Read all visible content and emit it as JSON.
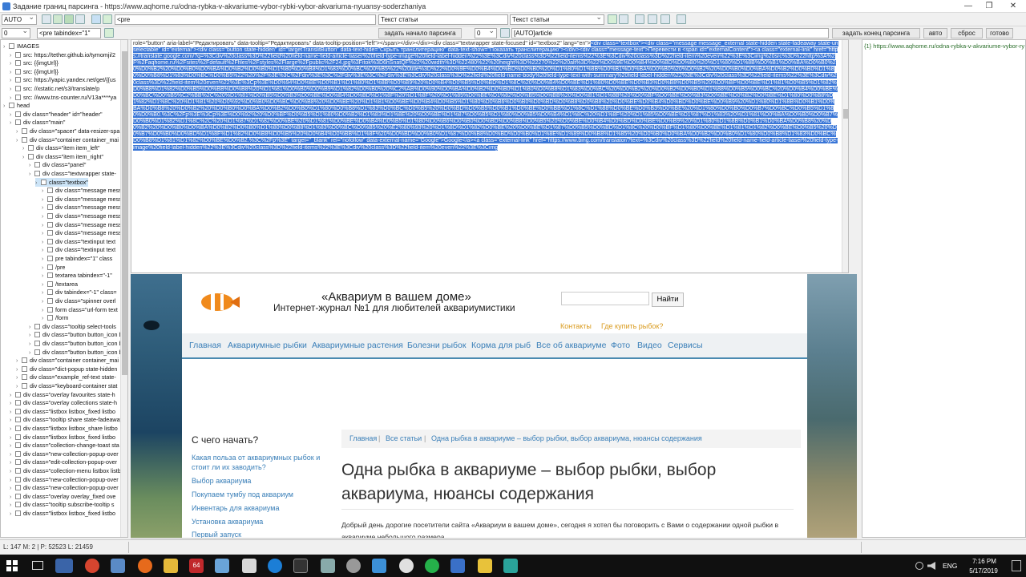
{
  "window": {
    "title": "Задание границ парсинга - https://www.aqhome.ru/odna-rybka-v-akvariume-vybor-rybki-vybor-akvariuma-nyuansy-soderzhaniya",
    "minimize": "—",
    "restore": "❐",
    "close": "✕"
  },
  "toolbar1": {
    "mode_select": "AUTO",
    "pre_field": "<pre",
    "text_field1": "Текст статьи",
    "text_select2": "Текст статьи"
  },
  "toolbar2": {
    "num_field1": "0",
    "tag_field": "<pre tabindex=\"1\"",
    "start_button": "задать начало парсинга",
    "num_field2": "0",
    "auto_field": "[AUTO]article",
    "end_button": "задать конец парсинга",
    "auto_button": "авто",
    "reset_button": "сброс",
    "done_button": "готово"
  },
  "tree": {
    "rows": [
      "IMAGES",
      "src: https://tether.github.io/tymomji/2",
      "src: {{imgUrl}}",
      "src: {{imgUrl}}",
      "src: https://yapic.yandex.net/get/{{us",
      "src: //xstatic.net/s3/translate/p",
      "src: //www.tns-counter.ru/V13a****ya",
      "head",
      "div class=\"header\" id=\"header\"",
      "div class=\"main\"",
      "div class=\"spacer\" data-resizer-spa",
      "div class=\"container container_mai",
      "div class=\"item item_left\"",
      "div class=\"item item_right\"",
      "div class=\"panel\"",
      "div class=\"textwrapper state-",
      "class=\"textbox\"",
      "div class=\"message mess",
      "div class=\"message mess",
      "div class=\"message mess",
      "div class=\"message mess",
      "div class=\"message mess",
      "div class=\"message mess",
      "div class=\"textinput text",
      "div class=\"textinput text",
      "pre tabindex=\"1\" class",
      "/pre",
      "textarea tabindex=\"-1\" ",
      "/textarea",
      "div tabindex=\"-1\" class=",
      "div class=\"spinner overl",
      "form class=\"url-form text",
      "/form",
      "div class=\"tooltip select-tools",
      "div class=\"button button_icon bi",
      "div class=\"button button_icon bi",
      "div class=\"button button_icon bi",
      "div class=\"container container_mai",
      "div class=\"dict-popup state-hidden",
      "div class=\"example_ref-text state-",
      "div class=\"keyboard-container stat",
      "div class=\"overlay favourites state-h",
      "div class=\"overlay collections state-h",
      "div class=\"listbox listbox_fixed listbo",
      "div class=\"tooltip share state-fadeaway sta",
      "div class=\"listbox listbox_share listbo",
      "div class=\"listbox listbox_fixed listbo",
      "div class=\"collection-change-toast sta",
      "div class=\"new-collection-popup-over",
      "div class=\"edit-collection-popup-over",
      "div class=\"collection-menu listbox listb",
      "div class=\"new-collection-popup-over",
      "div class=\"new-collection-popup-over",
      "div class=\"overlay overlay_fixed ove",
      "div class=\"tooltip subscribe-tooltip s",
      "div class=\"listbox listbox_fixed listbo"
    ]
  },
  "code": {
    "plain_head": "role=\"button\" aria-label=\"Редактировать\" data-tooltip=\"Редактировать\" data-tooltip-position=\"left\"></span></div></div><div class=\"textwrapper state-focused\" id=\"textbox2\" lang=\"en\">",
    "selected": "<div class=\"textbox\"><div class=\"message message_external state-hidden state-fadeaway state-unselectable\" id=\"external\"><div class=\"button state-hidden\" id=\"targetTranslitButton\" data-text-hide=\"Скрыть транслитерацию\" data-text-show=\"Показать транслитерацию\"></div><div class=\"message-text\">Перевести в <span id=\"externalContent\"><a class=\"external-link\" href=\"https://translate.google.com/?q=%3Cdiv%20class%3D%22field%20field-name-field-article-tiaser%20field-type-image%20field-label-hidden%22%3E%3Cdiv%20class%3D%22field-items%22%3E%3Cdiv%20class%3D%22field-item%20even%22%3E%3Cimg%20src%3D%22http%3A%2F%2Faqhome.ru%2Fsites%2Fdefault%2Ffiles%2Fstyles%2Flarge%2Fpublic%2F24.jpg%3Fitok%3D6hSnatQF%22%20width%3D%22480%22%20height%3D%22270%22%20alt%3D%22%D0%9E%D0%B4%D0%BD%D0%B0%20%D1%80%D1%8B%D0%B1%D0%BA%D0%B0%20%D0%B2%20%D0%B0%D0%BA%D0%B2%D0%B0%D1%80%D0%B8%D1%83%D0%BC%D0%B5%22%20title%3D%22%D0%9E%D0%B4%D0%BD%D0%B0%20%D1%80%D1%8B%D0%B1%D0%BA%D0%B0%20%D0%B2%20%D0%B0%D0%BA%D0%B2%D0%B0%D1%80%D0%B8%D1%83%D0%BC%D0%B5%22%20%2F%3E%3C%2Fdiv%3E%3C%2Fdiv%3E%3C%2Fdiv%3E%3Cdiv%20class%3D%22field%20field-name-body%20field-type-text-with-summary%20field-label-hidden%22%3E%3Cdiv%20class%3D%22field-items%22%3E%3Cdiv%20class%3D%22field-item%20even%22%3E%3Cp%3E%D0%94%D0%BE%D0%B1%D1%80%D1%8B%D0%B9%20%D0%B4%D0%B5%D0%BD%D1%8C%20%D0%B4%D0%BE%D1%80%D0%BE%D0%B3%D0%B8%D0%B5%20%D0%BF%D0%BE%D1%81%D0%B5%D1%82%D0%B8%D1%82%D0%B5%D0%BB%D0%B8%20%D1%81%D0%B0%D0%B9%D1%82%D0%B0%20%C2%AB%D0%90%D0%BA%D0%B2%D0%B0%D1%80%D0%B8%D1%83%D0%BC%20%D0%B2%20%D0%B2%D0%B0%D1%88%D0%B5%D0%BC%20%D0%B4%D0%BE%D0%BC%D0%B5%C2%BB%2C%20%D1%81%D0%B5%D0%B3%D0%BE%D0%B4%D0%BD%D1%8F%20%D1%8F%20%D1%85%D0%BE%D1%82%D0%B5%D0%BB%20%D0%B1%D1%8B%20%D0%BF%D0%BE%D0%B3%D0%BE%D0%B2%D0%BE%D1%80%D0%B8%D1%82%D1%8C%20%D1%81%20%D0%92%D0%B0%D0%BC%D0%B8%20%D0%BE%20%D1%81%D0%BE%D0%B4%D0%B5%D1%80%D0%B6%D0%B0%D0%BD%D0%B8%D0%B8%20%D0%BE%D0%B4%D0%BD%D0%BE%D0%B9%20%D1%80%D1%8B%D0%B1%D0%BA%D0%B8%20%D0%B2%20%D0%B0%D0%BA%D0%B2%D0%B0%D1%80%D0%B8%D1%83%D0%BC%D0%B5%20%D0%BD%D0%B5%D0%B1%D0%BE%D0%BB%D1%8C%D1%88%D0%BE%D0%B3%D0%BE%20%D1%80%D0%B0%D0%B7%D0%BC%D0%B5%D1%80%D0%B0.%3C%2Fp%3E%3Cp%3E%D0%92%20%D0%BF%D0%B5%D1%80%D0%B2%D1%83%D1%8E%20%D0%BE%D1%87%D0%B5%D1%80%D0%B5%D0%B4%D1%8C%20%D1%8F%20%D1%85%D0%BE%D1%87%D1%83%20%D1%81%D0%BA%D0%B0%D0%B7%D0%B0%D1%82%D1%8C%2C%20%D1%87%D1%82%D0%BE%20%D1%81%D0%BE%D0%B4%D0%B5%D1%80%D0%B6%D0%B0%D0%BD%D0%B8%D0%B5%20%D0%BE%D0%B4%D0%BD%D0%BE%D0%B9%20%D1%80%D1%8B%D0%B1%D0%BA%D0%B8%20%D0%B2%20%D0%B0%D0%BA%D0%B2%D0%B0%D1%80%D0%B8%D1%83%D0%BC%D0%B5%20%E2%80%93%20%D1%8D%D1%82%D0%BE%20%D0%BE%D1%87%D0%B5%D0%BD%D1%8C%20%D0%BF%D1%80%D0%BE%D1%81%D1%82%D0%BE%D0%B5%20%D0%B7%D0%B0%D0%BD%D1%8F%D1%82%D0%B8%D0%B5%20%D0%B4%D0%BB%D1%8F%20%D0%BD%D0%B0%D1%87%D0%B8%D0%BD%D0%B0%D1%8E%D1%89%D0%B8%D1%85%20%D0%B0%D0%BA%D0%B2%D0%B0%D1%80%D0%B8%D1%83%D0%BC%D0%B8%D1%81%D1%82%D0%BE%D0%B2.%3C%2Fp%3E\" target=\"_blank\" rel=\"nofollow\" data-external-name=\"Google\">Google</a><a class=\"external-link\" href=\"https://www.bing.com/translator/?text=%3Cdiv%20class%3D%22field%20field-name-field-article-tiaser%20field-type-image%20field-label-hidden%22%3E%3Cdiv%20class%3D%22field-items%22%3E%3Cdiv%20class%3D%22field-item%20even%22%3E%3Cimg"
  },
  "right_panel": {
    "entry": "{1} https://www.aqhome.ru/odna-rybka-v-akvariume-vybor-rybki"
  },
  "site": {
    "title": "«Аквариум в вашем доме»",
    "subtitle": "Интернет-журнал №1 для любителей аквариумистики",
    "search_button": "Найти",
    "contacts": "Контакты",
    "where_buy": "Где купить рыбок?",
    "nav": [
      "Главная",
      "Аквариумные рыбки",
      "Аквариумные растения",
      "Болезни рыбок",
      "Корма для рыб",
      "Все об аквариуме",
      "Фото",
      "Видео",
      "Сервисы"
    ],
    "sidebar_heading": "С чего начать?",
    "sidebar_links": [
      "Какая польза от аквариумных рыбок и стоит ли их заводить?",
      "Выбор аквариума",
      "Покупаем тумбу под аквариум",
      "Инвентарь для аквариума",
      "Установка аквариума",
      "Первый запуск"
    ],
    "breadcrumb": [
      "Главная",
      "Все статьи",
      "Одна рыбка в аквариуме – выбор рыбки, выбор аквариума, нюансы содержания"
    ],
    "article_title": "Одна рыбка в аквариуме – выбор рыбки, выбор аквариума, нюансы содержания",
    "article_text": "Добрый день дорогие посетители сайта «Аквариум в вашем доме», сегодня я хотел бы поговорить с Вами о содержании одной рыбки в аквариуме небольшого размера."
  },
  "status": {
    "left": "L: 147  M: 2  |  P: 52523  L: 21459"
  },
  "taskbar": {
    "lang": "ENG",
    "time": "7:16 PM",
    "date": "5/17/2019"
  },
  "colors": {
    "selection": "#3875d7",
    "link": "#3a7fb8",
    "taskbar": "#101010"
  }
}
